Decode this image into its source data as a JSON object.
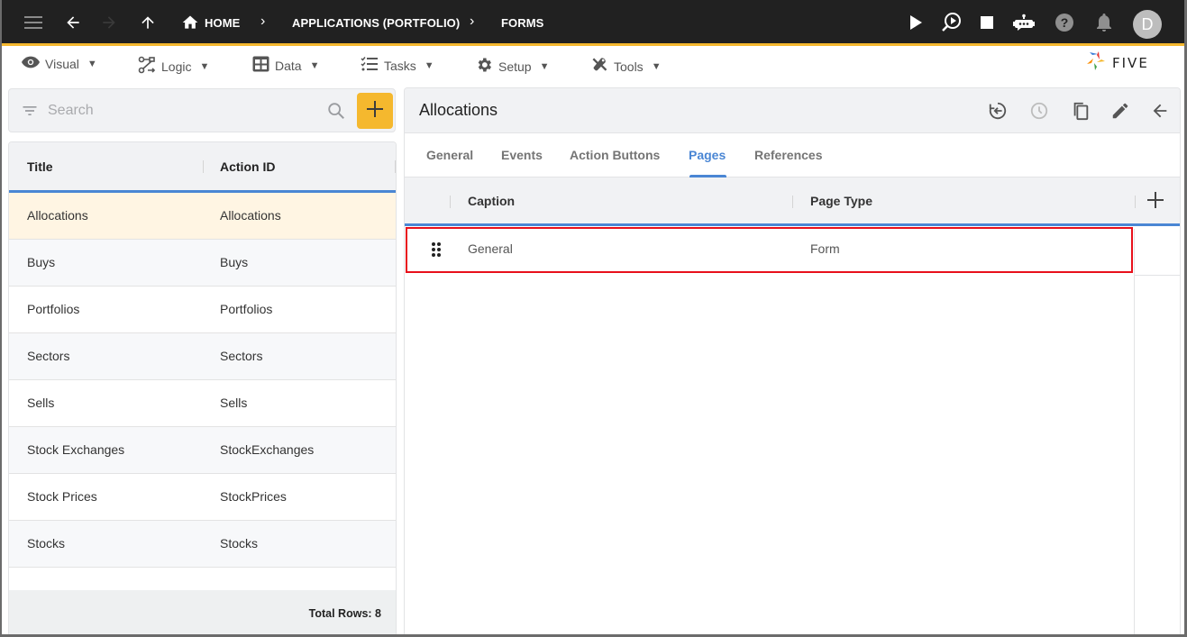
{
  "appbar": {
    "breadcrumbs": [
      {
        "label": "HOME",
        "icon": "home-icon"
      },
      {
        "label": "APPLICATIONS (PORTFOLIO)"
      },
      {
        "label": "FORMS"
      }
    ],
    "separator": "›",
    "avatar_initial": "D",
    "icons": [
      "menu-icon",
      "back-arrow-icon",
      "forward-arrow-icon",
      "up-arrow-icon",
      "run-icon",
      "debug-run-icon",
      "stop-icon",
      "chatbot-icon",
      "help-icon",
      "notifications-icon"
    ]
  },
  "menubar": {
    "items": [
      {
        "label": "Visual",
        "icon": "eye-icon"
      },
      {
        "label": "Logic",
        "icon": "logic-flow-icon"
      },
      {
        "label": "Data",
        "icon": "table-grid-icon"
      },
      {
        "label": "Tasks",
        "icon": "checklist-icon"
      },
      {
        "label": "Setup",
        "icon": "gear-icon"
      },
      {
        "label": "Tools",
        "icon": "tools-icon"
      }
    ],
    "caret": "▼",
    "logo_text": "FIVE"
  },
  "search": {
    "placeholder": "Search",
    "value": ""
  },
  "list": {
    "columns": [
      "Title",
      "Action ID"
    ],
    "rows": [
      {
        "title": "Allocations",
        "action_id": "Allocations",
        "selected": true
      },
      {
        "title": "Buys",
        "action_id": "Buys"
      },
      {
        "title": "Portfolios",
        "action_id": "Portfolios"
      },
      {
        "title": "Sectors",
        "action_id": "Sectors"
      },
      {
        "title": "Sells",
        "action_id": "Sells"
      },
      {
        "title": "Stock Exchanges",
        "action_id": "StockExchanges"
      },
      {
        "title": "Stock Prices",
        "action_id": "StockPrices"
      },
      {
        "title": "Stocks",
        "action_id": "Stocks"
      }
    ],
    "footer": "Total Rows: 8"
  },
  "detail": {
    "title": "Allocations",
    "header_icons": [
      "restore-icon",
      "history-icon",
      "copy-icon",
      "edit-icon",
      "close-back-icon"
    ],
    "tabs": [
      {
        "label": "General"
      },
      {
        "label": "Events"
      },
      {
        "label": "Action Buttons"
      },
      {
        "label": "Pages",
        "active": true
      },
      {
        "label": "References"
      }
    ],
    "grid": {
      "columns": [
        "Caption",
        "Page Type"
      ],
      "rows": [
        {
          "caption": "General",
          "page_type": "Form",
          "highlighted": true
        }
      ]
    }
  },
  "colors": {
    "accent": "#f5b82e",
    "primary_blue": "#4a86d4",
    "highlight_red": "#e8101b",
    "appbar_bg": "#212121",
    "selected_row": "#fff5e3"
  }
}
